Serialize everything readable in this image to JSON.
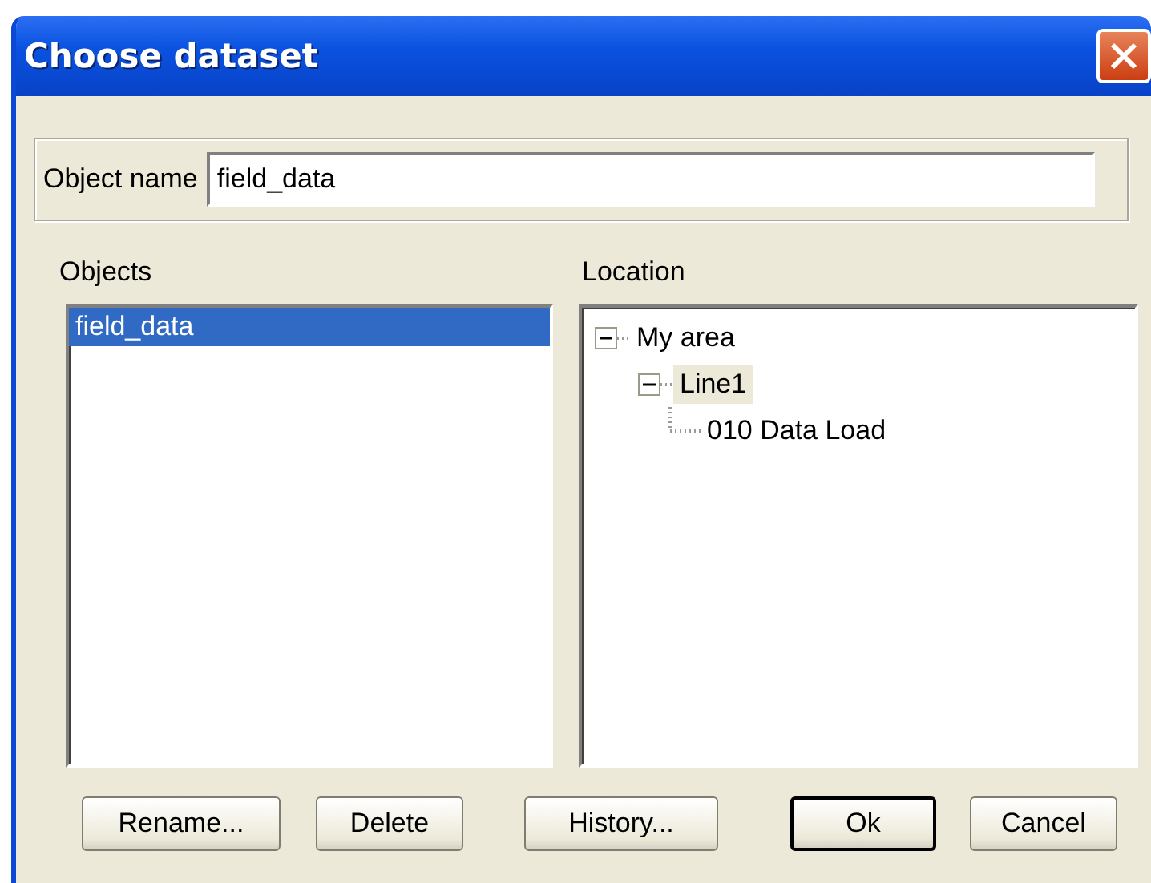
{
  "window": {
    "title": "Choose dataset"
  },
  "object_name": {
    "label": "Object name",
    "value": "field_data"
  },
  "objects": {
    "label": "Objects",
    "items": [
      {
        "label": "field_data",
        "selected": true
      }
    ]
  },
  "location": {
    "label": "Location",
    "tree": [
      {
        "label": "My area",
        "expanded": true,
        "selected": false,
        "children": [
          {
            "label": "Line1",
            "expanded": true,
            "selected": true,
            "children": [
              {
                "label": "010 Data Load",
                "selected": false
              }
            ]
          }
        ]
      }
    ]
  },
  "buttons": [
    {
      "label": "Rename...",
      "default": false
    },
    {
      "label": "Delete",
      "default": false
    },
    {
      "label": "History...",
      "default": false
    },
    {
      "label": "Ok",
      "default": true
    },
    {
      "label": "Cancel",
      "default": false
    }
  ]
}
